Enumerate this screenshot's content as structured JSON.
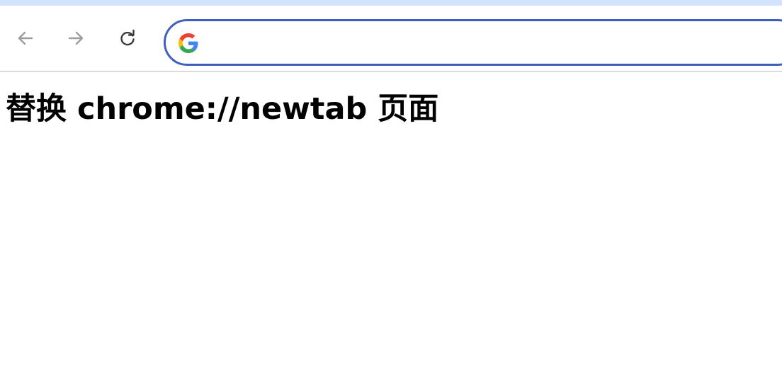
{
  "browser": {
    "toolbar": {
      "back_icon": "arrow-left-icon",
      "forward_icon": "arrow-right-icon",
      "reload_icon": "reload-icon"
    },
    "omnibox": {
      "value": "",
      "placeholder": "",
      "icon": "google-g-icon"
    },
    "colors": {
      "tabstrip": "#d3e3fd",
      "omnibox_focus_border": "#3f5fbd",
      "nav_icon_disabled": "#9e9e9e",
      "nav_icon_active": "#3c3c3c"
    }
  },
  "page": {
    "title": "替换 chrome://newtab 页面"
  }
}
